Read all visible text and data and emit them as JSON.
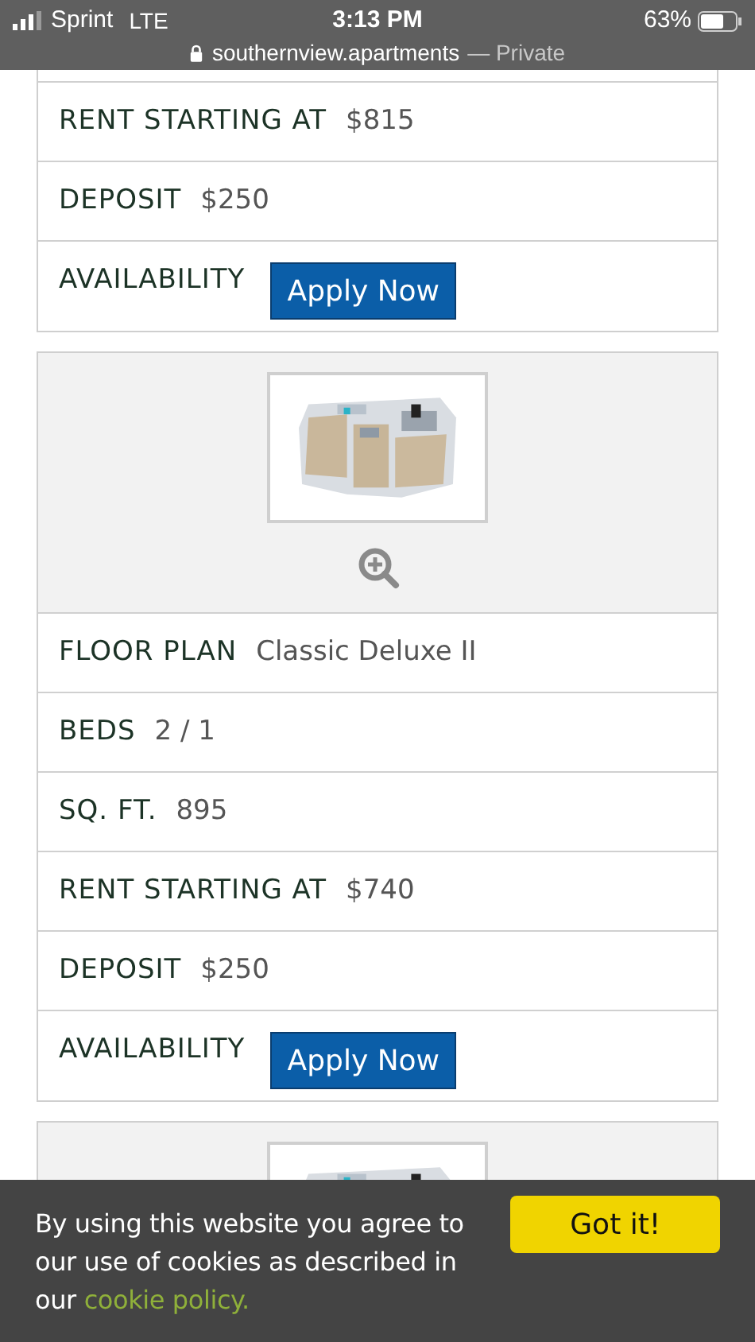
{
  "status_bar": {
    "carrier": "Sprint",
    "network": "LTE",
    "time": "3:13 PM",
    "battery": "63%",
    "url": "southernview.apartments",
    "private": "— Private"
  },
  "cards": [
    {
      "rows": [
        {
          "kind": "text",
          "label": "RENT STARTING AT",
          "value": "$815"
        },
        {
          "kind": "text",
          "label": "DEPOSIT",
          "value": "$250"
        },
        {
          "kind": "button",
          "label": "AVAILABILITY",
          "button": "Apply Now"
        }
      ]
    },
    {
      "image": {
        "kind": "picture"
      },
      "rows": [
        {
          "kind": "text",
          "label": "FLOOR PLAN",
          "value": "Classic Deluxe II"
        },
        {
          "kind": "text",
          "label": "BEDS",
          "value": "2 / 1"
        },
        {
          "kind": "text",
          "label": "SQ. FT.",
          "value": "895"
        },
        {
          "kind": "text",
          "label": "RENT STARTING AT",
          "value": "$740"
        },
        {
          "kind": "text",
          "label": "DEPOSIT",
          "value": "$250"
        },
        {
          "kind": "button",
          "label": "AVAILABILITY",
          "button": "Apply Now"
        }
      ]
    },
    {
      "image": {
        "kind": "picture"
      }
    }
  ],
  "cookie_banner": {
    "text": "By using this website you agree to our use of cookies as described in our",
    "link": "cookie policy.",
    "button": "Got it!"
  }
}
